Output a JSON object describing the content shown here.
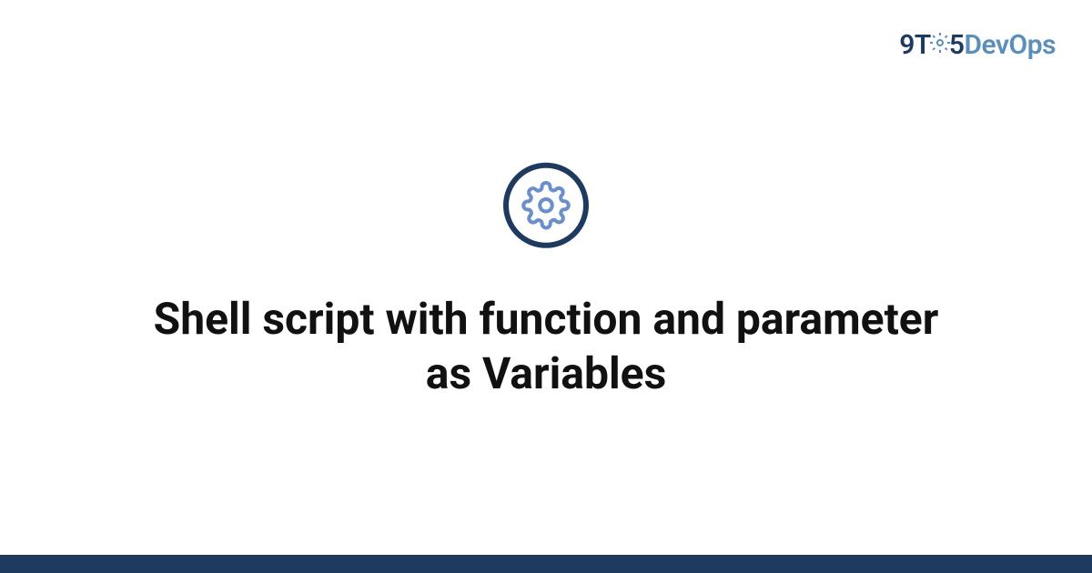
{
  "logo": {
    "prefix": "9T",
    "middle": "5",
    "suffix": "DevOps"
  },
  "title": "Shell script with function and parameter as Variables",
  "colors": {
    "dark_navy": "#1e3a5f",
    "light_blue": "#5b8fb9",
    "icon_blue": "#6b8fc9"
  }
}
